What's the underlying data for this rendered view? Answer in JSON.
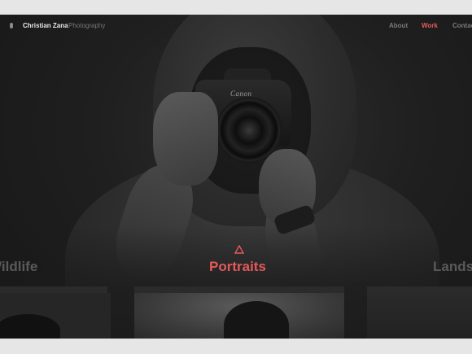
{
  "nav": {
    "brand_name": "Christian Zana",
    "brand_sub": "Photography",
    "links": [
      {
        "label": "About"
      },
      {
        "label": "Work"
      },
      {
        "label": "Contact"
      }
    ],
    "active_link": "Work"
  },
  "hero": {
    "camera_brand": "Canon"
  },
  "categories": [
    {
      "label": "Wildlife"
    },
    {
      "label": "Portraits"
    },
    {
      "label": "Landscapes"
    }
  ],
  "active_category": "Portraits",
  "colors": {
    "accent": "#e4595a",
    "background": "#1b1b1b",
    "muted_text": "#5a5a5a"
  },
  "icons": {
    "active_category_marker": "triangle-icon",
    "brand_mark": "logo-mark-icon"
  }
}
